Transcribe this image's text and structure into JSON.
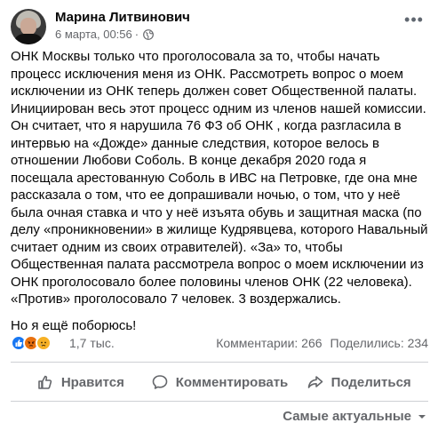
{
  "author": {
    "name": "Марина Литвинович",
    "date": "6 марта, 00:56",
    "separator": "·"
  },
  "post": {
    "paragraphs": [
      "ОНК Москвы только что проголосовала за то, чтобы  начать процесс исключения меня из ОНК. Рассмотреть вопрос о моем исключении из ОНК теперь должен совет Общественной палаты. Инициирован весь этот процесс одним из членов нашей комиссии. Он считает, что я нарушила 76 ФЗ об ОНК , когда разгласила в интервью на «Дожде» данные следствия, которое велось в отношении Любови Соболь. В конце декабря 2020 года я посещала арестованную Соболь в ИВС на Петровке, где она мне рассказала о том, что ее допрашивали ночью, о том, что у неё была очная ставка и что у неё изъята обувь и защитная маска (по делу «проникновении» в жилище Кудрявцева, которого Навальный считает одним из своих отравителей). «За» то, чтобы Общественная палата рассмотрела вопрос о моем исключении из ОНК проголосовало более половины членов ОНК (22 человека). «Против» проголосовало 7 человек. 3 воздержались.",
      "Но я ещё поборюсь!"
    ]
  },
  "reactions": {
    "count": "1,7 тыс.",
    "comments": "Комментарии: 266",
    "shares": "Поделились: 234",
    "icons": [
      "like-icon",
      "angry-icon",
      "sad-icon"
    ]
  },
  "actions": {
    "like": "Нравится",
    "comment": "Комментировать",
    "share": "Поделиться"
  },
  "sort": {
    "label": "Самые актуальные"
  },
  "colors": {
    "text": "#050505",
    "muted": "#65676b",
    "like_blue": "#1877f2",
    "divider": "#ced0d4"
  }
}
